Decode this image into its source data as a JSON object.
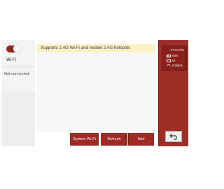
{
  "colors": {
    "accent": "#9d2b24",
    "notice_bg": "#fbf0c7"
  },
  "wifi": {
    "label": "Wi-Fi",
    "toggle_on": true,
    "status": "Not connected"
  },
  "notice": {
    "text": "Supports 2.4G Wi-Fi and mobile 2.4G hotspots"
  },
  "buttons": {
    "system_wifi": "System Wi-Fi",
    "refresh": "Refresh",
    "add": "Add"
  },
  "status_bar": {
    "time": "07:34 PM",
    "battery": "63%",
    "row2": "0s",
    "wifi": "0.0Mb/s"
  },
  "icons": {
    "back": "back-arrow-icon",
    "battery": "battery-icon",
    "wifi": "wifi-icon"
  }
}
